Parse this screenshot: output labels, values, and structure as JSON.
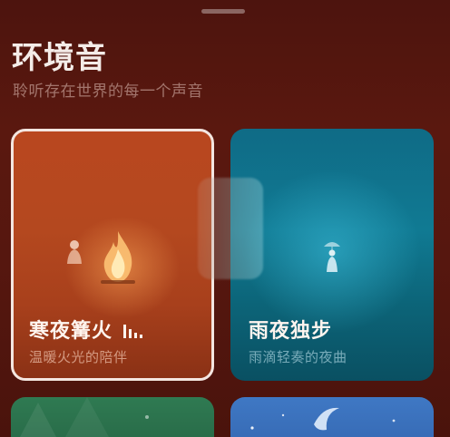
{
  "header": {
    "title": "环境音",
    "subtitle": "聆听存在世界的每一个声音"
  },
  "cards": [
    {
      "label": "寒夜篝火",
      "desc": "温暖火光的陪伴",
      "playing": true,
      "icon": "sound-wave-icon",
      "color": "#b4481f"
    },
    {
      "label": "雨夜独步",
      "desc": "雨滴轻奏的夜曲",
      "playing": false,
      "color": "#107a93"
    }
  ],
  "colors": {
    "background": "#56170f",
    "selected_border": "#f4e6e0"
  }
}
